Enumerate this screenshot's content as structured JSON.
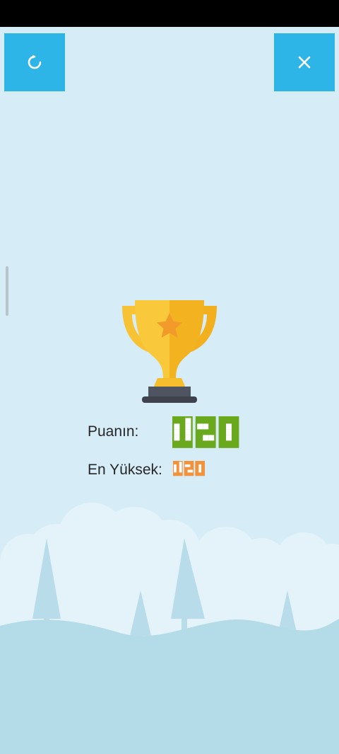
{
  "colors": {
    "background": "#d6edf7",
    "button": "#2db5e8",
    "score_color": "#6aa81e",
    "high_color": "#f2923a",
    "hill": "#b4dbe8",
    "cloud": "#e6f4fb",
    "tree": "#b8dceb"
  },
  "icons": {
    "restart": "restart-icon",
    "close": "close-icon",
    "trophy": "trophy-icon"
  },
  "score": {
    "label": "Puanın:",
    "value": "120"
  },
  "high_score": {
    "label": "En Yüksek:",
    "value": "120"
  }
}
